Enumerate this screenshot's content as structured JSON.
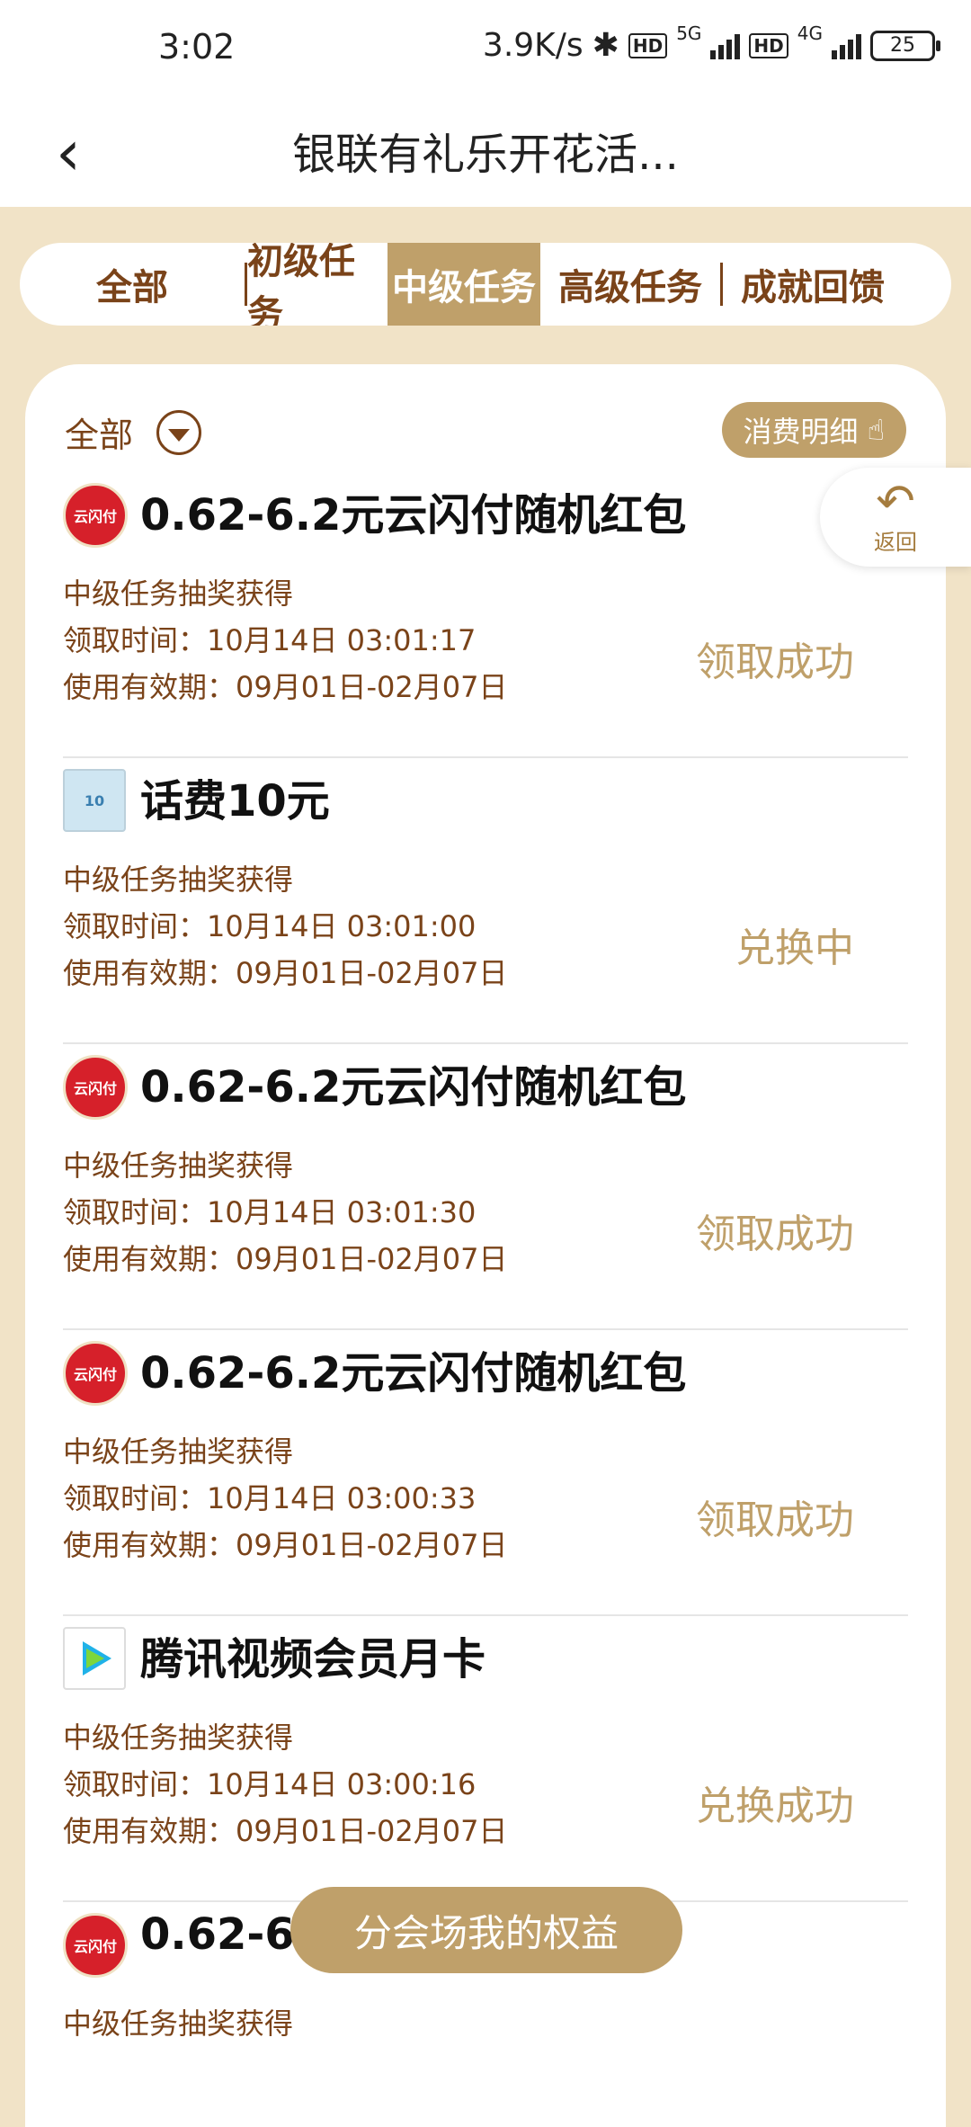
{
  "status_bar": {
    "time": "3:02",
    "speed": "3.9K/s",
    "network1": "5G",
    "network2": "4G",
    "battery": "25",
    "hd": "HD"
  },
  "header": {
    "back_icon": "chevron-left-icon",
    "title": "银联有礼乐开花活..."
  },
  "tabs": [
    {
      "label": "全部",
      "active": false
    },
    {
      "label": "初级任务",
      "active": false
    },
    {
      "label": "中级任务",
      "active": true
    },
    {
      "label": "高级任务",
      "active": false
    },
    {
      "label": "成就回馈",
      "active": false
    }
  ],
  "filter": {
    "label": "全部",
    "icon": "dropdown-icon"
  },
  "detail_button": {
    "label": "消费明细",
    "icon": "hand-pointer-icon"
  },
  "return_button": {
    "label": "返回",
    "icon": "return-arrow-icon"
  },
  "items": [
    {
      "icon": "云闪付",
      "icon_sub": "UnionPay",
      "title": "0.62-6.2元云闪付随机红包",
      "source": "中级任务抽奖获得",
      "time": "领取时间：10月14日 03:01:17",
      "validity": "使用有效期：09月01日-02月07日",
      "status": "领取成功"
    },
    {
      "icon": "话费",
      "icon_sub": "10",
      "title": "话费10元",
      "source": "中级任务抽奖获得",
      "time": "领取时间：10月14日 03:01:00",
      "validity": "使用有效期：09月01日-02月07日",
      "status": "兑换中"
    },
    {
      "icon": "云闪付",
      "icon_sub": "UnionPay",
      "title": "0.62-6.2元云闪付随机红包",
      "source": "中级任务抽奖获得",
      "time": "领取时间：10月14日 03:01:30",
      "validity": "使用有效期：09月01日-02月07日",
      "status": "领取成功"
    },
    {
      "icon": "云闪付",
      "icon_sub": "UnionPay",
      "title": "0.62-6.2元云闪付随机红包",
      "source": "中级任务抽奖获得",
      "time": "领取时间：10月14日 03:00:33",
      "validity": "使用有效期：09月01日-02月07日",
      "status": "领取成功"
    },
    {
      "icon": "play-icon",
      "icon_sub": "",
      "title": "腾讯视频会员月卡",
      "source": "中级任务抽奖获得",
      "time": "领取时间：10月14日 03:00:16",
      "validity": "使用有效期：09月01日-02月07日",
      "status": "兑换成功"
    },
    {
      "icon": "云闪付",
      "icon_sub": "UnionPay",
      "title": "0.62-6.2",
      "source": "中级任务抽奖获得",
      "time": "",
      "validity": "",
      "status": ""
    }
  ],
  "bottom_button": {
    "label": "分会场我的权益"
  }
}
